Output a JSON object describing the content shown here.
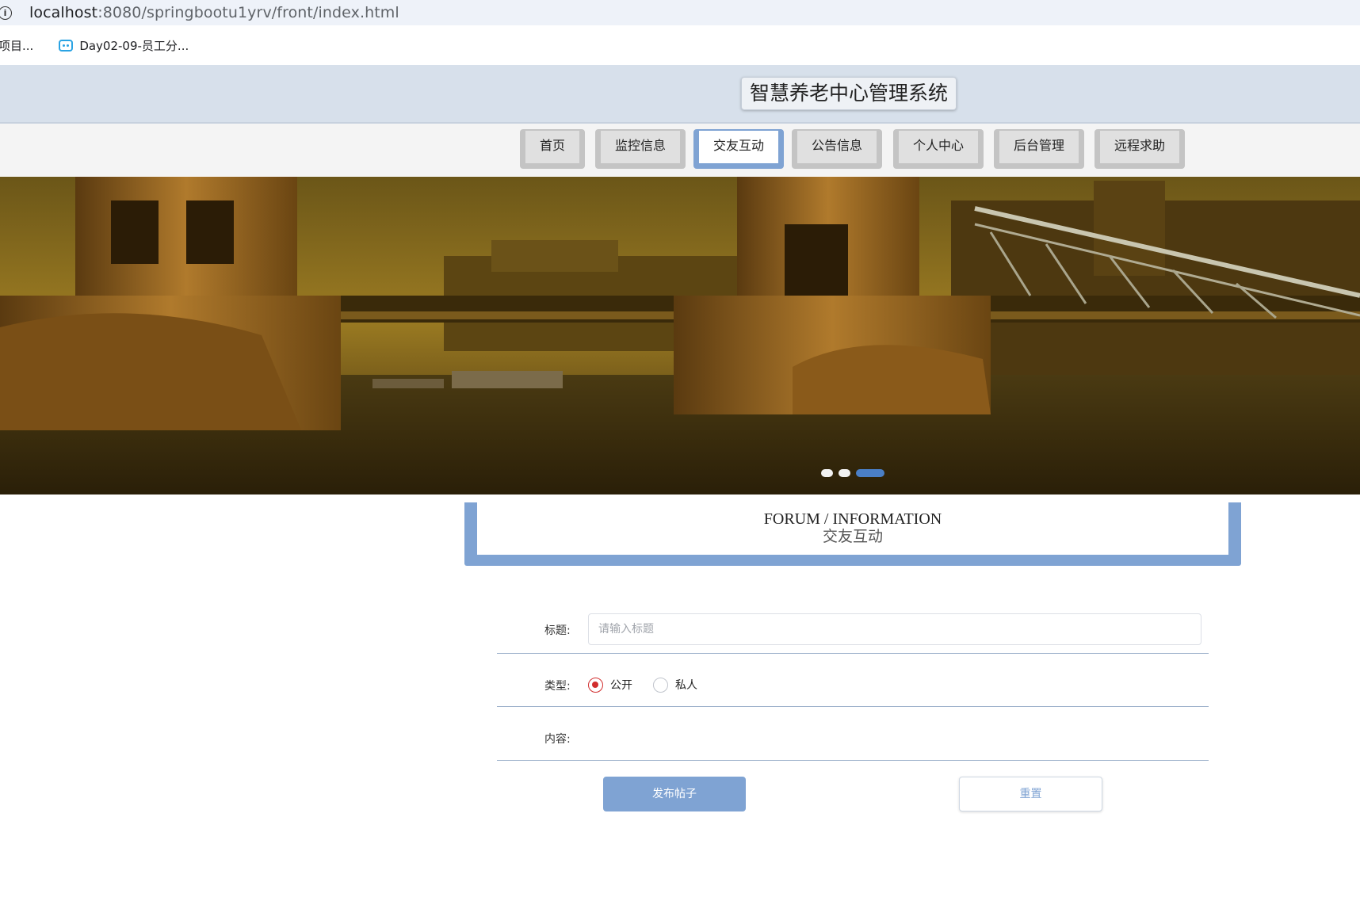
{
  "browser": {
    "url_host": "localhost",
    "url_path": ":8080/springbootu1yrv/front/index.html",
    "bookmarks": [
      {
        "label": "项目..."
      },
      {
        "label": "Day02-09-员工分..."
      }
    ]
  },
  "header": {
    "title": "智慧养老中心管理系统"
  },
  "nav": {
    "items": [
      {
        "label": "首页"
      },
      {
        "label": "监控信息"
      },
      {
        "label": "交友互动"
      },
      {
        "label": "公告信息"
      },
      {
        "label": "个人中心"
      },
      {
        "label": "后台管理"
      },
      {
        "label": "远程求助"
      }
    ],
    "active_index": 2
  },
  "carousel": {
    "slide_count": 3,
    "active_slide": 3
  },
  "section": {
    "title_en": "FORUM / INFORMATION",
    "title_cn": "交友互动"
  },
  "form": {
    "title_label": "标题:",
    "title_value": "",
    "title_placeholder": "请输入标题",
    "type_label": "类型:",
    "type_options": [
      "公开",
      "私人"
    ],
    "type_selected": "公开",
    "content_label": "内容:",
    "submit_label": "发布帖子",
    "reset_label": "重置"
  },
  "colors": {
    "accent": "#7fa3d3",
    "radio_checked": "#d12d2d",
    "header_bg": "#d7e0eb"
  }
}
